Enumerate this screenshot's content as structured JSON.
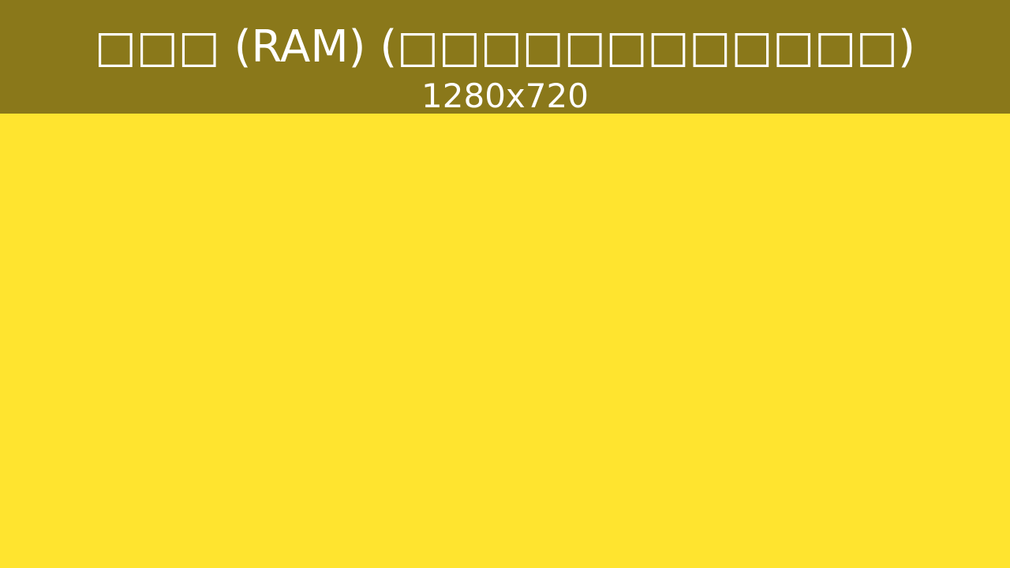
{
  "header": {
    "title": "□□□ (RAM) (□□□□□□□□□□□□)",
    "subtitle": "1280x720"
  },
  "colors": {
    "header_background": "#8a781a",
    "page_background": "#ffe42f",
    "text": "#ffffff"
  }
}
